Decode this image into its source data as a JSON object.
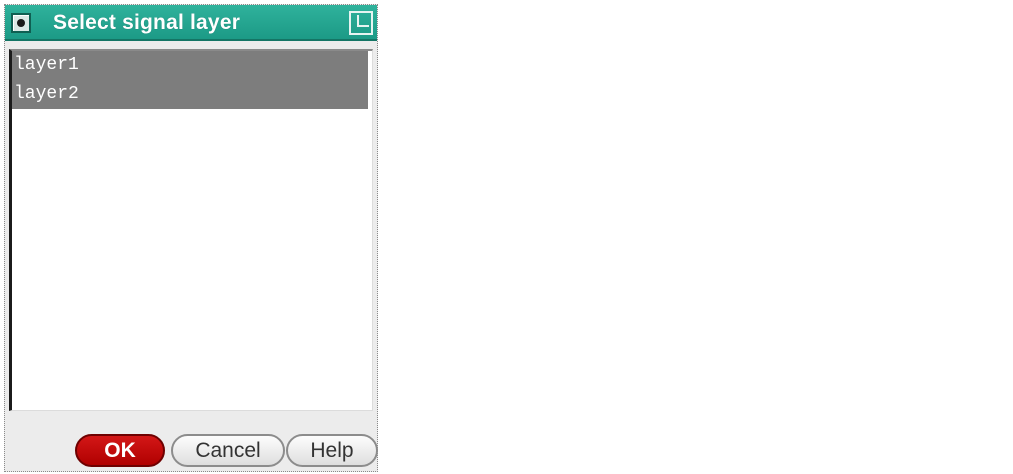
{
  "window": {
    "title": "Select signal layer",
    "menu_icon": "window-menu-icon",
    "maximize_icon": "maximize-icon",
    "titlebar_color": "#1fa38e"
  },
  "list": {
    "items": [
      {
        "label": "layer1",
        "selected": true
      },
      {
        "label": "layer2",
        "selected": true
      }
    ],
    "selection_color": "#7d7d7d"
  },
  "buttons": {
    "ok": "OK",
    "cancel": "Cancel",
    "help": "Help",
    "ok_color": "#c20000"
  }
}
